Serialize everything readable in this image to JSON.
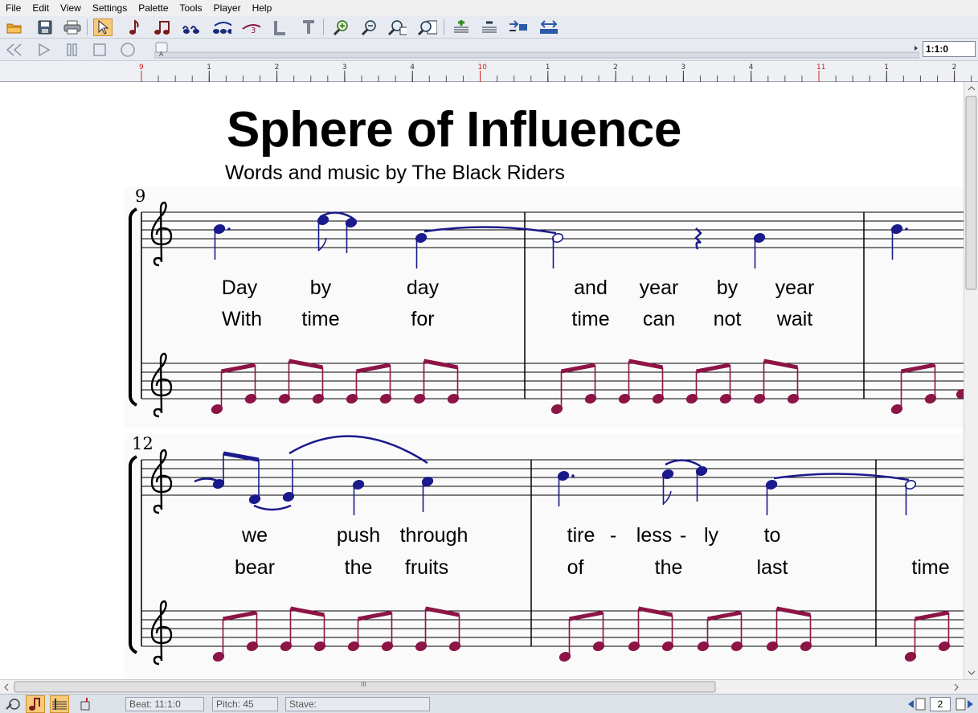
{
  "menu": [
    "File",
    "Edit",
    "View",
    "Settings",
    "Palette",
    "Tools",
    "Player",
    "Help"
  ],
  "toolbar": {
    "icons": [
      "open-icon",
      "save-icon",
      "print-icon",
      "select-arrow-icon",
      "eighth-note-icon",
      "beamed-notes-icon",
      "quarter-notes-icon",
      "triplet-quarter-icon",
      "tuplet-3-icon",
      "lyric-tool-icon",
      "text-tool-icon",
      "zoom-in-icon",
      "zoom-out-icon",
      "zoom-fit-icon",
      "zoom-page-icon",
      "add-staff-icon",
      "remove-staff-icon",
      "move-up-icon",
      "move-down-icon"
    ]
  },
  "transport": {
    "icons": [
      "rewind-icon",
      "play-icon",
      "pause-icon",
      "stop-icon",
      "record-icon"
    ],
    "position": "1:1:0",
    "slider_marker": "A"
  },
  "ruler": {
    "labels": [
      {
        "text": "9",
        "red": true
      },
      {
        "text": "1",
        "red": false
      },
      {
        "text": "2",
        "red": false
      },
      {
        "text": "3",
        "red": false
      },
      {
        "text": "4",
        "red": false
      },
      {
        "text": "10",
        "red": true
      },
      {
        "text": "1",
        "red": false
      },
      {
        "text": "2",
        "red": false
      },
      {
        "text": "3",
        "red": false
      },
      {
        "text": "4",
        "red": false
      },
      {
        "text": "11",
        "red": true
      },
      {
        "text": "1",
        "red": false
      },
      {
        "text": "2",
        "red": false
      }
    ]
  },
  "score": {
    "title": "Sphere of Influence",
    "subtitle": "Words and music by The Black Riders",
    "systems": [
      {
        "measure_number": "9",
        "verse1": [
          "Day",
          "by",
          "day",
          "and",
          "year",
          "by",
          "year"
        ],
        "verse2": [
          "With",
          "time",
          "for",
          "time",
          "can",
          "not",
          "wait"
        ]
      },
      {
        "measure_number": "12",
        "verse1": [
          "we",
          "push",
          "through",
          "tire",
          "-",
          "less",
          "-",
          "ly",
          "to"
        ],
        "verse2": [
          "bear",
          "the",
          "fruits",
          "of",
          "the",
          "last",
          "time"
        ]
      }
    ],
    "colors": {
      "melody": "#1a1a8c",
      "accompaniment": "#8c1446"
    }
  },
  "hscroll": {
    "grip": "III"
  },
  "status": {
    "beat": "Beat:  11:1:0",
    "pitch": "Pitch:  45",
    "stave": "Stave:",
    "page": "2"
  }
}
